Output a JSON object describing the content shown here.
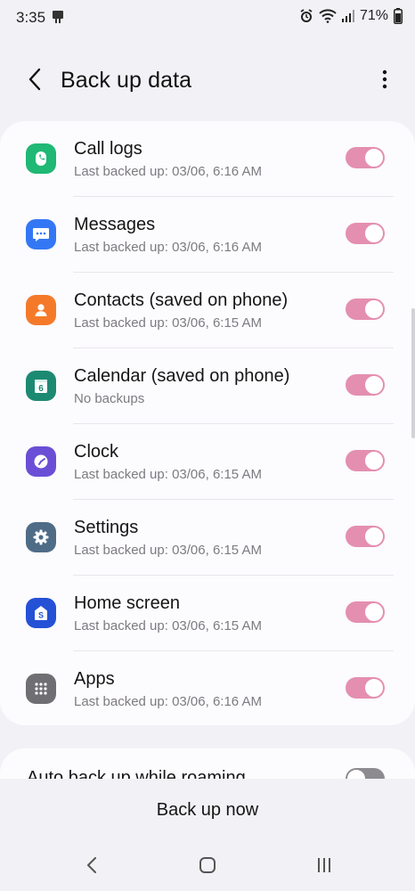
{
  "status_bar": {
    "time": "3:35",
    "battery": "71%"
  },
  "header": {
    "title": "Back up data",
    "back_icon": "chevron-left-icon",
    "more_icon": "more-vert-icon"
  },
  "items": [
    {
      "title": "Call logs",
      "subtitle": "Last backed up: 03/06, 6:16 AM",
      "icon": "phone-icon",
      "icon_color": "#1fb874",
      "enabled": true
    },
    {
      "title": "Messages",
      "subtitle": "Last backed up: 03/06, 6:16 AM",
      "icon": "chat-bubble-icon",
      "icon_color": "#3477f5",
      "enabled": true
    },
    {
      "title": "Contacts (saved on phone)",
      "subtitle": "Last backed up: 03/06, 6:15 AM",
      "icon": "person-icon",
      "icon_color": "#f47a2a",
      "enabled": true
    },
    {
      "title": "Calendar (saved on phone)",
      "subtitle": "No backups",
      "icon": "calendar-icon",
      "icon_color": "#1c8a72",
      "calendar_day": "6",
      "enabled": true
    },
    {
      "title": "Clock",
      "subtitle": "Last backed up: 03/06, 6:15 AM",
      "icon": "clock-icon",
      "icon_color": "#6a4fd6",
      "enabled": true
    },
    {
      "title": "Settings",
      "subtitle": "Last backed up: 03/06, 6:15 AM",
      "icon": "gear-icon",
      "icon_color": "#4f6c87",
      "enabled": true
    },
    {
      "title": "Home screen",
      "subtitle": "Last backed up: 03/06, 6:15 AM",
      "icon": "home-screen-icon",
      "icon_color": "#2451d6",
      "enabled": true
    },
    {
      "title": "Apps",
      "subtitle": "Last backed up: 03/06, 6:16 AM",
      "icon": "apps-grid-icon",
      "icon_color": "#6f6f73",
      "enabled": true
    }
  ],
  "auto_backup": {
    "label": "Auto back up while roaming",
    "enabled": false
  },
  "footer": {
    "backup_now": "Back up now"
  },
  "nav": {
    "back_icon": "nav-back-icon",
    "home_icon": "nav-home-icon",
    "recents_icon": "nav-recents-icon"
  },
  "colors": {
    "toggle_on": "#e48fb0",
    "toggle_off": "#8d8b90",
    "background": "#f2f1f5",
    "card": "#fcfbfd"
  }
}
